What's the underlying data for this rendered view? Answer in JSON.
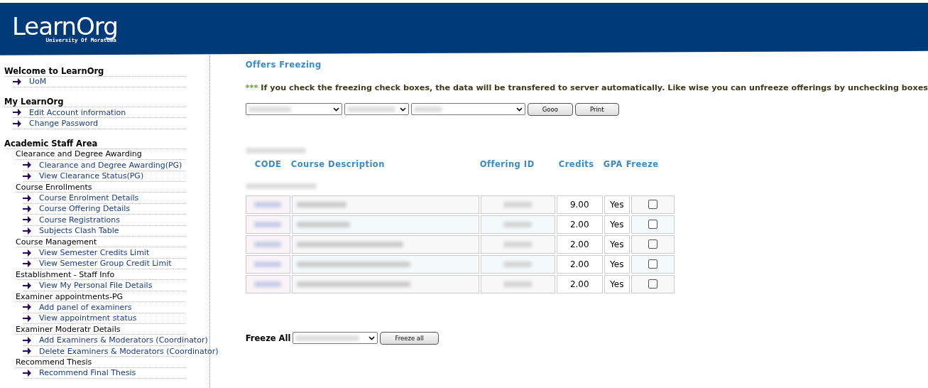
{
  "header": {
    "logo": "LearnOrg",
    "subtitle": "University Of Moratuwa"
  },
  "sidebar": {
    "sections": [
      {
        "title": "Welcome to LearnOrg",
        "items": [
          {
            "kind": "link",
            "label": "UoM"
          }
        ]
      },
      {
        "title": "My LearnOrg",
        "items": [
          {
            "kind": "link",
            "label": "Edit Account information"
          },
          {
            "kind": "link",
            "label": "Change Password"
          }
        ]
      },
      {
        "title": "Academic Staff Area",
        "items": [
          {
            "kind": "group",
            "label": "Clearance and Degree Awarding",
            "children": [
              {
                "label": "Clearance and Degree Awarding(PG)"
              },
              {
                "label": "View Clearance Status(PG)"
              }
            ]
          },
          {
            "kind": "group",
            "label": "Course Enrollments",
            "children": [
              {
                "label": "Course Enrolment Details"
              },
              {
                "label": "Course Offering Details"
              },
              {
                "label": "Course Registrations"
              },
              {
                "label": "Subjects Clash Table"
              }
            ]
          },
          {
            "kind": "group",
            "label": "Course Management",
            "children": [
              {
                "label": "View Semester Credits Limit"
              },
              {
                "label": "View Semester Group Credit Limit"
              }
            ]
          },
          {
            "kind": "group",
            "label": "Establishment - Staff Info",
            "children": [
              {
                "label": "View My Personal File Details"
              }
            ]
          },
          {
            "kind": "group",
            "label": "Examiner appointments-PG",
            "children": [
              {
                "label": "Add panel of examiners"
              },
              {
                "label": "View appointment status"
              }
            ]
          },
          {
            "kind": "group",
            "label": "Examiner Moderatr Details",
            "children": [
              {
                "label": "Add Examiners & Moderators (Coordinator)"
              },
              {
                "label": "Delete Examiners & Moderators (Coordinator)"
              }
            ]
          },
          {
            "kind": "group",
            "label": "Recommend Thesis",
            "children": [
              {
                "label": "Recommend Final Thesis"
              }
            ]
          }
        ]
      }
    ]
  },
  "main": {
    "title": "Offers Freezing",
    "note": {
      "marker": "***",
      "text": "If you check the freezing check boxes, the data will be transfered to server automatically. Like wise you can unfreeze offerings by unchecking boxes"
    },
    "buttons": [
      "Gooo",
      "Print"
    ],
    "table": {
      "columns": [
        "CODE",
        "Course Description",
        "Offering ID",
        "Credits",
        "GPA",
        "Freeze"
      ],
      "rows": [
        {
          "credits": "9.00",
          "gpa": "Yes",
          "freeze_checked": false
        },
        {
          "credits": "2.00",
          "gpa": "Yes",
          "freeze_checked": false
        },
        {
          "credits": "2.00",
          "gpa": "Yes",
          "freeze_checked": false
        },
        {
          "credits": "2.00",
          "gpa": "Yes",
          "freeze_checked": false
        },
        {
          "credits": "2.00",
          "gpa": "Yes",
          "freeze_checked": false
        }
      ]
    },
    "freeze_all": {
      "label": "Freeze All",
      "button": "Freeze all"
    }
  }
}
